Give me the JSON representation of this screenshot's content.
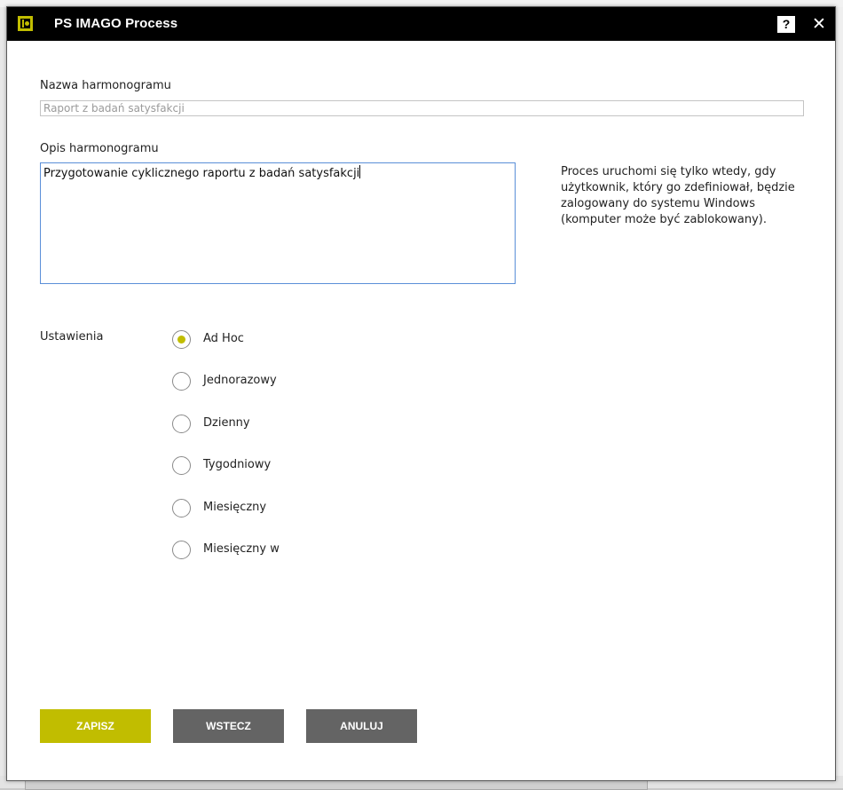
{
  "window": {
    "title": "PS IMAGO Process",
    "help_label": "?",
    "close_label": "✕"
  },
  "form": {
    "name_label": "Nazwa harmonogramu",
    "name_placeholder": "Raport z badań satysfakcji",
    "name_value": "",
    "description_label": "Opis harmonogramu",
    "description_value": "Przygotowanie cyklicznego raportu z badań satysfakcji",
    "info_text": "Proces uruchomi się tylko wtedy, gdy użytkownik, który go zdefiniował, będzie zalogowany do systemu Windows (komputer może być zablokowany).",
    "settings_label": "Ustawienia",
    "schedule_options": [
      {
        "label": "Ad Hoc",
        "selected": true
      },
      {
        "label": "Jednorazowy",
        "selected": false
      },
      {
        "label": "Dzienny",
        "selected": false
      },
      {
        "label": "Tygodniowy",
        "selected": false
      },
      {
        "label": "Miesięczny",
        "selected": false
      },
      {
        "label": "Miesięczny w",
        "selected": false
      }
    ]
  },
  "buttons": {
    "save": "ZAPISZ",
    "back": "WSTECZ",
    "cancel": "ANULUJ"
  },
  "colors": {
    "accent": "#c1bd00",
    "titlebar": "#000000",
    "secondary_button": "#646464",
    "focus_border": "#5a8fd8"
  }
}
